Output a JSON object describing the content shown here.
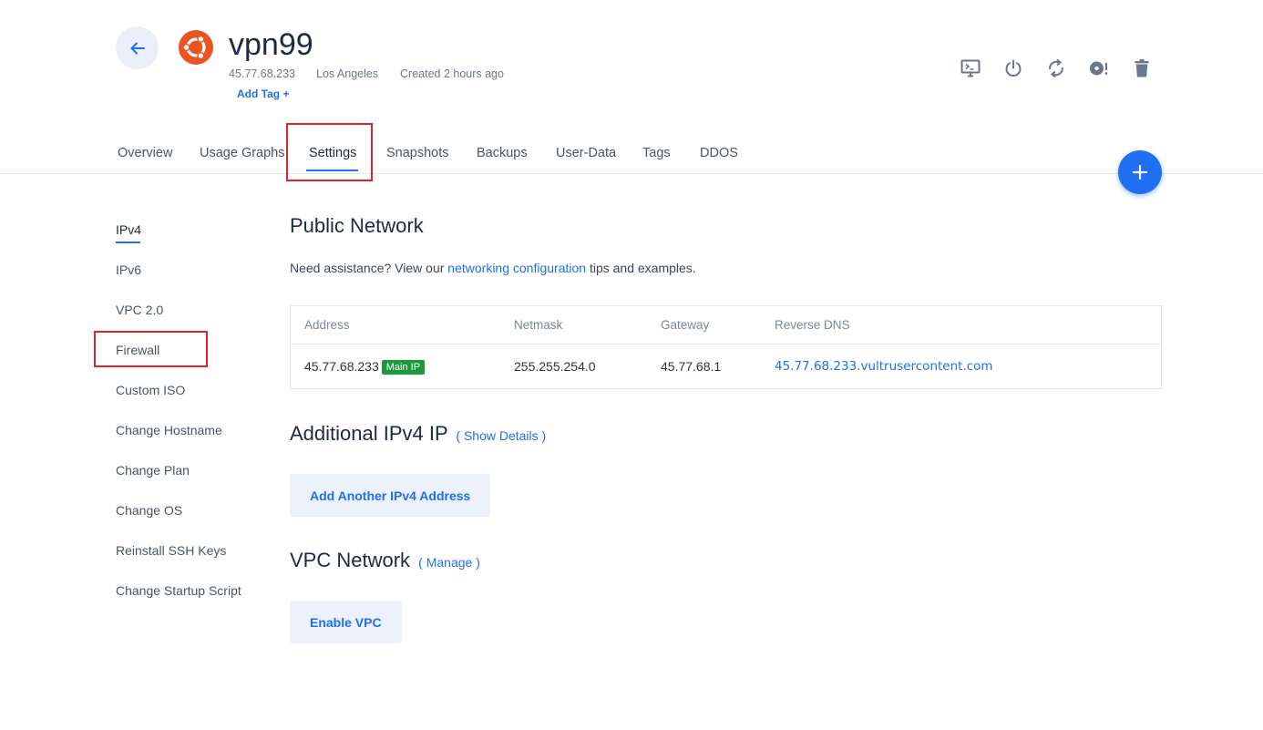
{
  "server": {
    "name": "vpn99",
    "ip": "45.77.68.233",
    "location": "Los Angeles",
    "created": "Created 2 hours ago",
    "add_tag": "Add Tag +"
  },
  "toolbar": {
    "icons": [
      "console-icon",
      "power-icon",
      "restart-icon",
      "iso-icon",
      "trash-icon"
    ]
  },
  "tabs": [
    {
      "label": "Overview"
    },
    {
      "label": "Usage Graphs"
    },
    {
      "label": "Settings",
      "active": true
    },
    {
      "label": "Snapshots"
    },
    {
      "label": "Backups"
    },
    {
      "label": "User-Data"
    },
    {
      "label": "Tags"
    },
    {
      "label": "DDOS"
    }
  ],
  "sidebar": {
    "items": [
      {
        "label": "IPv4",
        "active": true
      },
      {
        "label": "IPv6"
      },
      {
        "label": "VPC 2.0"
      },
      {
        "label": "Firewall"
      },
      {
        "label": "Custom ISO"
      },
      {
        "label": "Change Hostname"
      },
      {
        "label": "Change Plan"
      },
      {
        "label": "Change OS"
      },
      {
        "label": "Reinstall SSH Keys"
      },
      {
        "label": "Change Startup Script"
      }
    ]
  },
  "public_network": {
    "title": "Public Network",
    "assist_prefix": "Need assistance? View our ",
    "assist_link": "networking configuration",
    "assist_suffix": " tips and examples.",
    "columns": [
      "Address",
      "Netmask",
      "Gateway",
      "Reverse DNS"
    ],
    "row": {
      "address": "45.77.68.233",
      "badge": "Main IP",
      "netmask": "255.255.254.0",
      "gateway": "45.77.68.1",
      "reverse_dns": "45.77.68.233.vultrusercontent.com"
    }
  },
  "additional_ipv4": {
    "title": "Additional IPv4 IP",
    "link": "( Show Details )",
    "button": "Add Another IPv4 Address"
  },
  "vpc_network": {
    "title": "VPC Network",
    "link": "( Manage )",
    "button": "Enable VPC"
  },
  "colors": {
    "accent": "#1e6ff1",
    "highlight": "#e02424",
    "badge": "#1a9a3a",
    "os_logo": "#e95420"
  }
}
